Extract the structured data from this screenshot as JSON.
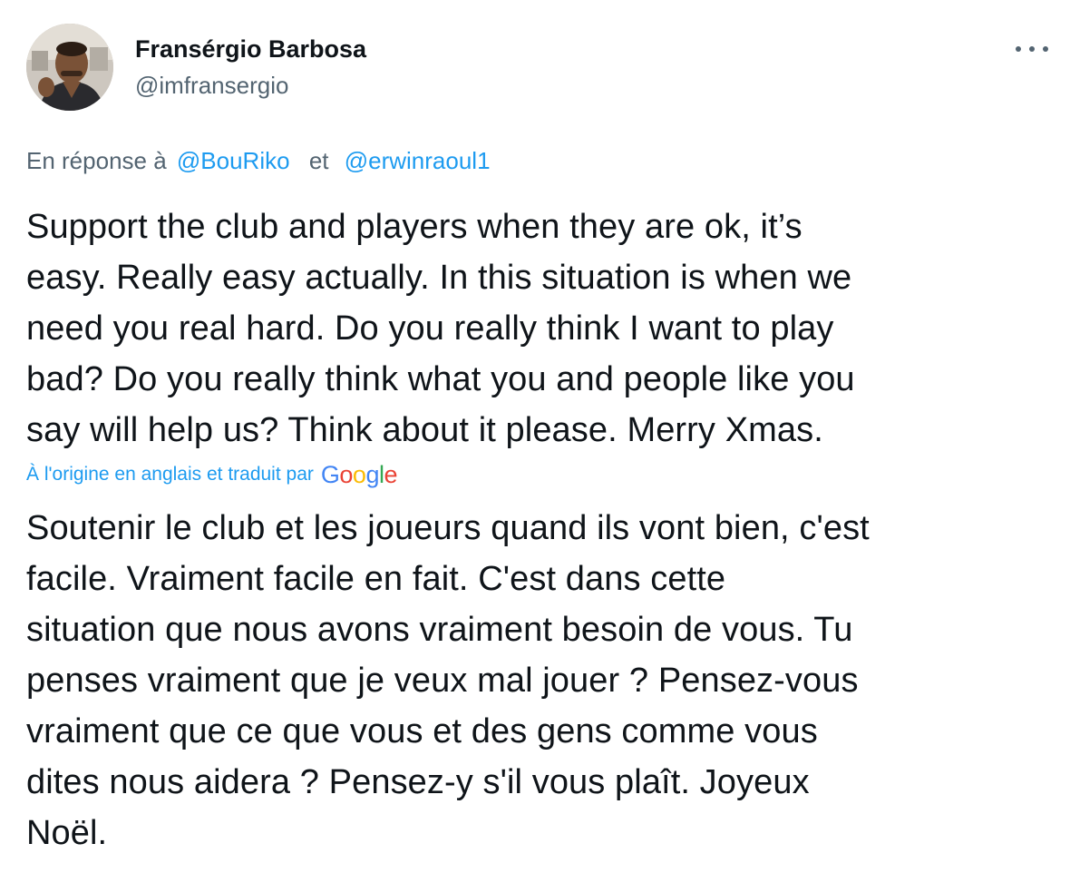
{
  "author": {
    "name": "Fransérgio Barbosa",
    "handle": "@imfransergio",
    "avatar_icon": "user-avatar"
  },
  "more_icon": "more-horizontal-icon",
  "reply": {
    "prefix": "En réponse à",
    "mention_1": "@BouRiko",
    "connector": "et",
    "mention_2": "@erwinraoul1"
  },
  "tweet_text": [
    "Support the club and players when they are ok, it’s",
    "easy. Really easy actually. In this situation is when we",
    "need you real hard. Do you really think I want to play",
    "bad? Do you really think what you and people like you",
    "say will help us? Think about it please. Merry Xmas."
  ],
  "translation": {
    "credit": "À l'origine en anglais et traduit par",
    "provider": "Google",
    "text": [
      "Soutenir le club et les joueurs quand ils vont bien, c'est",
      "facile. Vraiment facile en fait. C'est dans cette",
      "situation que nous avons vraiment besoin de vous. Tu",
      "penses vraiment que je veux mal jouer ? Pensez-vous",
      "vraiment que ce que vous et des gens comme vous",
      "dites nous aidera ? Pensez-y s'il vous plaît. Joyeux",
      "Noël."
    ]
  },
  "colors": {
    "text_primary": "#0f1419",
    "text_secondary": "#536471",
    "link": "#1d9bf0"
  }
}
